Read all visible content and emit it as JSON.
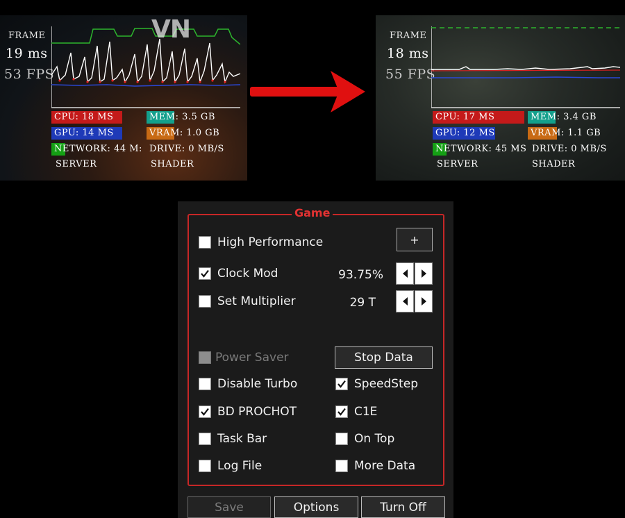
{
  "watermark": "VN",
  "overlay_before": {
    "frame_label": "Frame",
    "frame_ms": "19 ms",
    "fps": "53 FPS",
    "stats": {
      "cpu": "CPU: 18 ms",
      "gpu": "GPU: 14 ms",
      "network": "Network: 44 m:",
      "mem": "MEM: 3.5 GB",
      "vram": "VRAM: 1.0 GB",
      "drive": "Drive: 0 MB/S",
      "server": "Server",
      "shader": "Shader"
    }
  },
  "overlay_after": {
    "frame_label": "Frame",
    "frame_ms": "18 ms",
    "fps": "55 FPS",
    "stats": {
      "cpu": "CPU: 17 ms",
      "gpu": "GPU: 12 ms",
      "network": "Network: 45 ms",
      "mem": "MEM: 3.4 GB",
      "vram": "VRAM: 1.1 GB",
      "drive": "Drive: 0 MB/S",
      "server": "Server",
      "shader": "Shader"
    }
  },
  "colors": {
    "cpu_bar": "#c41a1a",
    "gpu_bar": "#1e3ab8",
    "network_bar": "#14a014",
    "mem_bar": "#13a08c",
    "vram_bar": "#c86a14",
    "arrow": "#e01010",
    "group_border": "#c72727"
  },
  "control": {
    "group_title": "Game",
    "plus_button": "+",
    "high_performance": {
      "label": "High Performance",
      "checked": false
    },
    "clock_mod": {
      "label": "Clock Mod",
      "checked": true,
      "value": "93.75%"
    },
    "set_multiplier": {
      "label": "Set Multiplier",
      "checked": false,
      "value": "29 T"
    },
    "power_saver": {
      "label": "Power Saver",
      "checked": false,
      "disabled": true
    },
    "stop_data_button": "Stop Data",
    "disable_turbo": {
      "label": "Disable Turbo",
      "checked": false
    },
    "speedstep": {
      "label": "SpeedStep",
      "checked": true
    },
    "bd_prochot": {
      "label": "BD PROCHOT",
      "checked": true
    },
    "c1e": {
      "label": "C1E",
      "checked": true
    },
    "task_bar": {
      "label": "Task Bar",
      "checked": false
    },
    "on_top": {
      "label": "On Top",
      "checked": false
    },
    "log_file": {
      "label": "Log File",
      "checked": false
    },
    "more_data": {
      "label": "More Data",
      "checked": false
    },
    "footer": {
      "save": "Save",
      "options": "Options",
      "turn_off": "Turn Off"
    }
  }
}
